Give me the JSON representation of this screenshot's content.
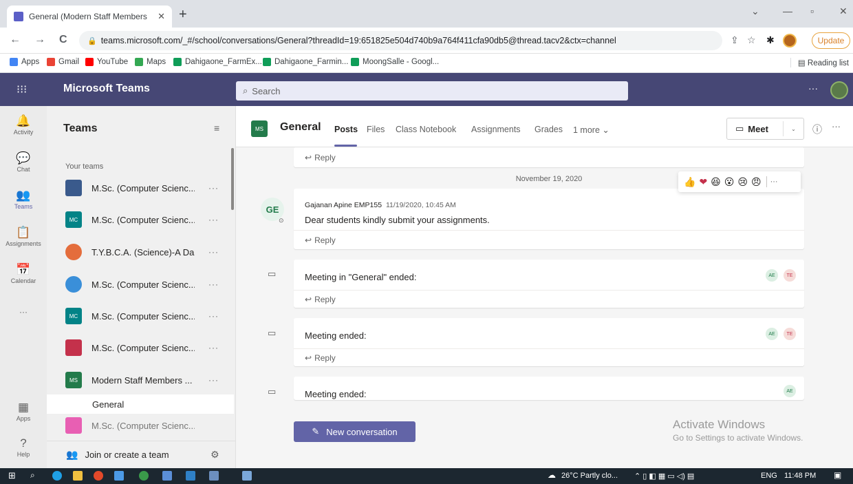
{
  "browser": {
    "tab_title": "General (Modern Staff Members",
    "tab_close": "✕",
    "new_tab": "+",
    "win_min": "—",
    "win_max": "▫",
    "win_close": "✕",
    "win_dropdown": "⌄",
    "back": "←",
    "forward": "→",
    "reload": "C",
    "url": "teams.microsoft.com/_#/school/conversations/General?threadId=19:651825e504d740b9a764f411cfa90db5@thread.tacv2&ctx=channel",
    "share_icon": "⇪",
    "star_icon": "☆",
    "ext_icon": "✱",
    "update_label": "Update",
    "bookmarks": [
      {
        "label": "Apps",
        "color": "#4285f4"
      },
      {
        "label": "Gmail",
        "color": "#ea4335"
      },
      {
        "label": "YouTube",
        "color": "#ff0000"
      },
      {
        "label": "Maps",
        "color": "#34a853"
      },
      {
        "label": "Dahigaone_FarmEx...",
        "color": "#0f9d58"
      },
      {
        "label": "Dahigaone_Farmin...",
        "color": "#0f9d58"
      },
      {
        "label": "MoongSalle - Googl...",
        "color": "#0f9d58"
      }
    ],
    "reading_list": "Reading list"
  },
  "teams": {
    "app_title": "Microsoft Teams",
    "search_placeholder": "Search",
    "header_more": "···",
    "rail": [
      {
        "label": "Activity",
        "icon": "🔔"
      },
      {
        "label": "Chat",
        "icon": "💬"
      },
      {
        "label": "Teams",
        "icon": "👥"
      },
      {
        "label": "Assignments",
        "icon": "📋"
      },
      {
        "label": "Calendar",
        "icon": "📅"
      },
      {
        "label": "···",
        "icon": ""
      },
      {
        "label": "Apps",
        "icon": "▦"
      },
      {
        "label": "Help",
        "icon": "?"
      }
    ],
    "panel_title": "Teams",
    "your_teams": "Your teams",
    "team_list": [
      {
        "name": "M.Sc. (Computer Scienc...",
        "badge": "",
        "color": "#3a5a8c"
      },
      {
        "name": "M.Sc. (Computer Scienc...",
        "badge": "MC",
        "color": "#038387"
      },
      {
        "name": "T.Y.B.C.A. (Science)-A Da...",
        "badge": "",
        "color": "#e46d3c"
      },
      {
        "name": "M.Sc. (Computer Scienc...",
        "badge": "",
        "color": "#3a8fd9"
      },
      {
        "name": "M.Sc. (Computer Scienc...",
        "badge": "MC",
        "color": "#038387"
      },
      {
        "name": "M.Sc. (Computer Scienc...",
        "badge": "",
        "color": "#c4314b"
      },
      {
        "name": "Modern Staff Members ...",
        "badge": "MS",
        "color": "#237b4b"
      },
      {
        "name": "M.Sc. (Computer Scienc...",
        "badge": "",
        "color": "#e3008c"
      }
    ],
    "team_more": "···",
    "channel": "General",
    "join_label": "Join or create a team",
    "channel_header": {
      "badge": "MS",
      "name": "General",
      "tabs": [
        "Posts",
        "Files",
        "Class Notebook",
        "Assignments",
        "Grades",
        "1 more ⌄"
      ],
      "meet_label": "Meet",
      "meet_caret": "⌄"
    },
    "reply_label": "Reply",
    "date_separator": "November 19, 2020",
    "reactions": [
      "👍",
      "❤",
      "😆",
      "😮",
      "😢",
      "😠"
    ],
    "reactions_more": "···",
    "message": {
      "avatar": "GE",
      "author": "Gajanan Apine EMP155",
      "time": "11/19/2020, 10:45 AM",
      "body": "Dear students kindly submit your assignments."
    },
    "meetings": [
      {
        "title": "Meeting in \"General\" ended:",
        "badges": [
          "AE",
          "TE"
        ]
      },
      {
        "title": "Meeting ended:",
        "badges": [
          "AE",
          "TE"
        ]
      },
      {
        "title": "Meeting ended:",
        "badges": [
          "AE"
        ]
      }
    ],
    "new_conversation": "New conversation",
    "activate_title": "Activate Windows",
    "activate_sub": "Go to Settings to activate Windows."
  },
  "taskbar": {
    "weather": "26°C  Partly clo...",
    "lang": "ENG",
    "time": "11:48 PM"
  }
}
